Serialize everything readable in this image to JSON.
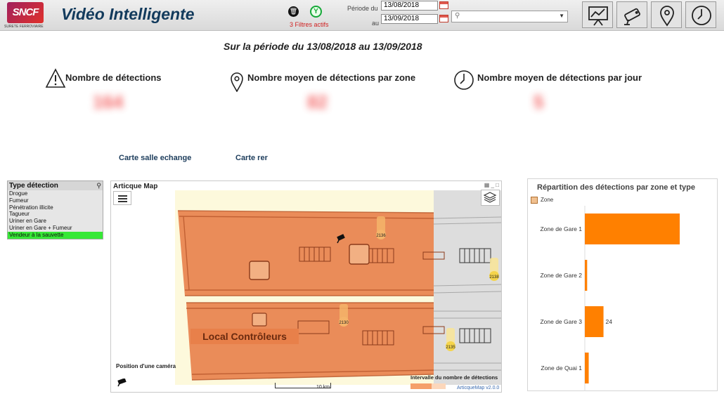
{
  "header": {
    "logo_text": "SNCF",
    "logo_sub": "SURETE FERROVIAIRE",
    "title": "Vidéo Intelligente",
    "filters_active": "3 Filtres actifs",
    "period_from_label": "Période du",
    "period_to_label": "au",
    "date_from": "13/08/2018",
    "date_to": "13/09/2018",
    "icons": [
      "trash-icon",
      "filter-icon",
      "presentation-chart-icon",
      "camera-icon",
      "location-pin-icon",
      "clock-icon"
    ]
  },
  "period_text": "Sur la période du 13/08/2018 au 13/09/2018",
  "kpis": [
    {
      "label": "Nombre de détections",
      "value": "164",
      "icon": "warning-icon"
    },
    {
      "label": "Nombre moyen de détections par zone",
      "value": "82",
      "icon": "location-pin-icon"
    },
    {
      "label": "Nombre moyen de détections par jour",
      "value": "5",
      "icon": "clock-icon"
    }
  ],
  "links": {
    "salle_echange": "Carte salle echange",
    "rer": "Carte rer"
  },
  "detection_types": {
    "title": "Type détection",
    "items": [
      "Drogue",
      "Fumeur",
      "Pénétration illicite",
      "Tagueur",
      "Uriner en Gare",
      "Uriner en Gare + Fumeur",
      "Vendeur à la sauvette"
    ],
    "selected": "Vendeur à la sauvette"
  },
  "map": {
    "title": "Articque Map",
    "room_label": "Local Contrôleurs",
    "camera_ids": [
      "2136",
      "2130",
      "2138",
      "2135"
    ],
    "camera_position_label": "Position d'une caméra",
    "scale_label": "10 km",
    "legend_title": "Intervalle du nombre de détections",
    "version": "ArticqueMap v2.0.0",
    "fill_color": "#e8804a",
    "floor_color": "#fdf9dc"
  },
  "chart_data": {
    "type": "bar",
    "title": "Répartition des détections par zone et type",
    "dimension_label": "Zone",
    "orientation": "horizontal",
    "categories": [
      "Zone de Gare 1",
      "Zone de Gare 2",
      "Zone de Gare 3",
      "Zone de Quai 1"
    ],
    "values": [
      122,
      3,
      24,
      5
    ],
    "value_labels": [
      "",
      "",
      "24",
      ""
    ],
    "bar_color": "#ff8000"
  }
}
